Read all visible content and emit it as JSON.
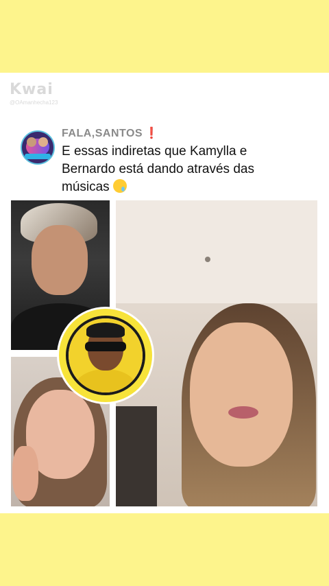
{
  "watermark": {
    "logo": "Kwai",
    "handle": "@OAmanhecha123"
  },
  "post": {
    "author": "FALA,SANTOS",
    "author_mark": "❗",
    "text": "E essas indiretas que Kamylla e Bernardo está dando através das músicas",
    "emoji_icon": "crying-face-emoji"
  },
  "colors": {
    "background_band": "#fdf48c",
    "badge_yellow": "#f7e33a",
    "author_gray": "#8a8a8a"
  }
}
